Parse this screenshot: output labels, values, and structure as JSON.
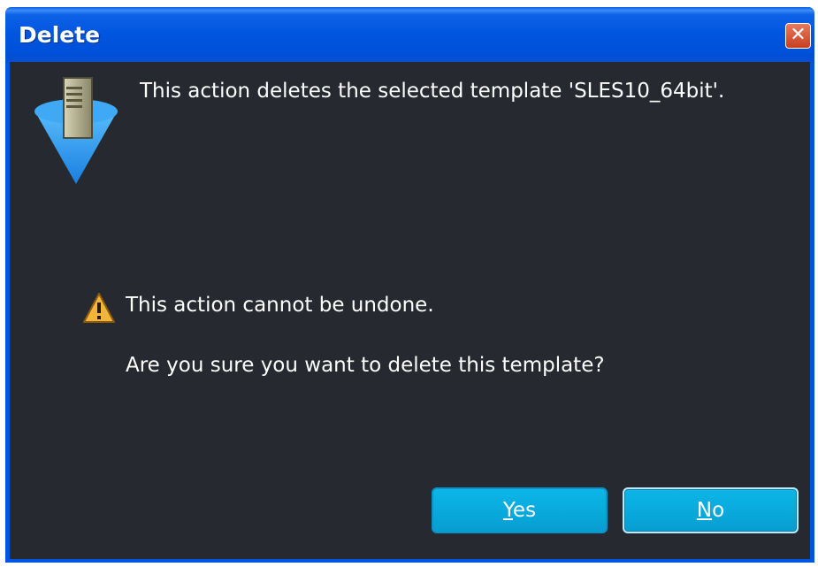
{
  "window": {
    "title": "Delete",
    "close_label": "✕"
  },
  "message": {
    "primary": "This action deletes the selected template 'SLES10_64bit'.",
    "warning": "This action cannot be undone.",
    "question": "Are you sure you want to delete this template?"
  },
  "buttons": {
    "yes": {
      "accel": "Y",
      "rest": "es"
    },
    "no": {
      "accel": "N",
      "rest": "o"
    }
  },
  "icons": {
    "app": "server-icon",
    "warning": "warning-icon",
    "close": "close-icon"
  },
  "colors": {
    "titlebar": "#0054e3",
    "content_bg": "#262a30",
    "button": "#079ed1",
    "close": "#c6401f",
    "text": "#ffffff"
  }
}
